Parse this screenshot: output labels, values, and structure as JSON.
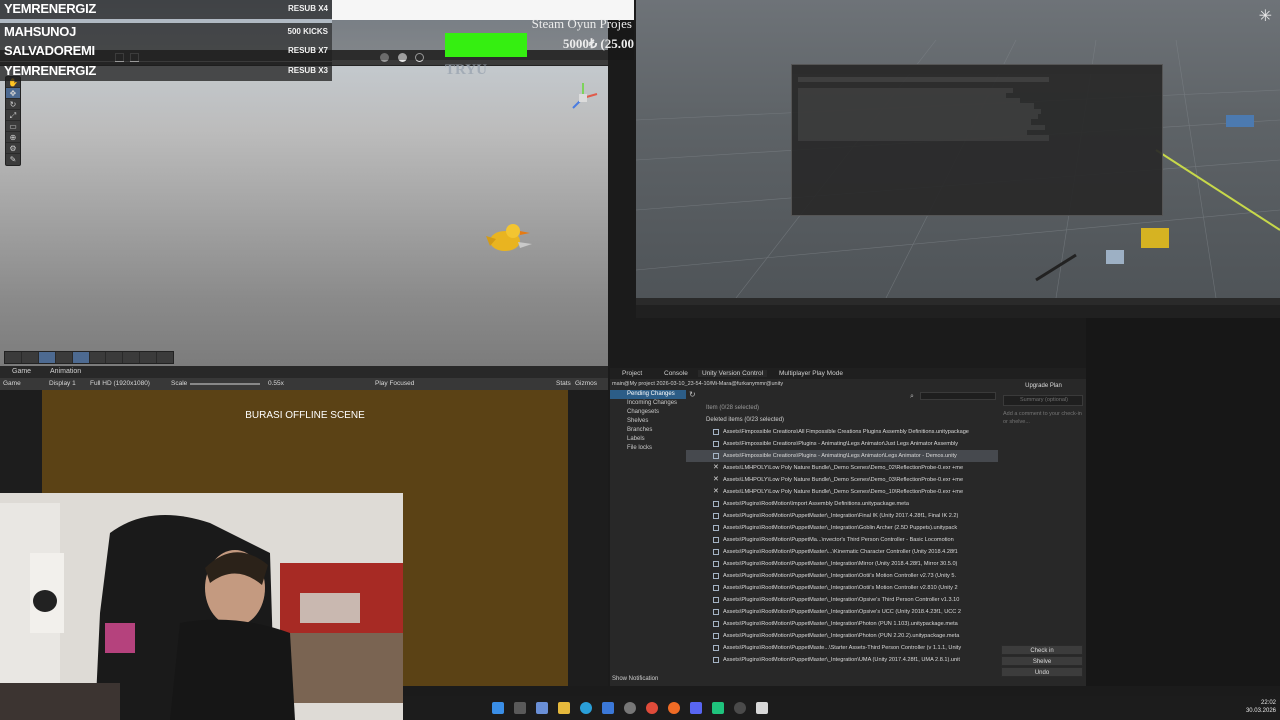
{
  "stream_overlay": {
    "rows": [
      {
        "name": "YEMRENERGIZ",
        "tag": "RESUB X4"
      },
      {
        "name": "MAHSUNOJ",
        "tag": "500 KICKS"
      },
      {
        "name": "SALVADOREMI",
        "tag": "RESUB X7"
      },
      {
        "name": "YEMRENERGIZ",
        "tag": "RESUB X3"
      }
    ],
    "goal_title": "Steam Oyun Projes",
    "goal_amount": "5000₺ (25.00",
    "goal_progress": 0.27,
    "scene_watermark": "TRYU"
  },
  "game_view": {
    "tabs": [
      "Game",
      "Animation"
    ],
    "toolbar": {
      "mode": "Game",
      "display": "Display 1",
      "resolution": "Full HD (1920x1080)",
      "scale_label": "Scale",
      "scale_value": "0.55x",
      "play_mode": "Play Focused",
      "stats": "Stats",
      "gizmos": "Gizmos"
    },
    "scene_text": "BURASI OFFLINE SCENE"
  },
  "version_control": {
    "tabs": [
      "Project",
      "Console",
      "Unity Version Control",
      "Multiplayer Play Mode"
    ],
    "path": "main@My project 2026-03-10_23-54-10/Mi-Mara@furkanymmr@unity",
    "nav": [
      "Pending Changes",
      "Incoming Changes",
      "Changesets",
      "Shelves",
      "Branches",
      "Labels",
      "File locks"
    ],
    "list_header": "Item  (0/28 selected)",
    "group": "Deleted items  (0/23 selected)",
    "rows": [
      "Assets\\Fimpossible Creations\\All Fimpossible Creations Plugins Assembly Definitions.unitypackage",
      "Assets\\Fimpossible Creations\\Plugins - Animating\\Legs Animator\\Just Legs Animator Assembly",
      "Assets\\Fimpossible Creations\\Plugins - Animating\\Legs Animator\\Legs Animator - Demos.unity",
      "Assets\\LMHPOLY\\Low Poly Nature Bundle\\_Demo Scenes\\Demo_02\\ReflectionProbe-0.exr +me",
      "Assets\\LMHPOLY\\Low Poly Nature Bundle\\_Demo Scenes\\Demo_03\\ReflectionProbe-0.exr +me",
      "Assets\\LMHPOLY\\Low Poly Nature Bundle\\_Demo Scenes\\Demo_10\\ReflectionProbe-0.exr +me",
      "Assets\\Plugins\\RootMotion\\Import Assembly Definitions.unitypackage.meta",
      "Assets\\Plugins\\RootMotion\\PuppetMaster\\_Integration\\Final IK (Unity 2017.4.28f1, Final IK 2.2)",
      "Assets\\Plugins\\RootMotion\\PuppetMaster\\_Integration\\Goblin Archer (2.5D Puppets).unitypack",
      "Assets\\Plugins\\RootMotion\\PuppetMa...\\nvector's Third Person Controller - Basic Locomotion",
      "Assets\\Plugins\\RootMotion\\PuppetMaster\\...\\Kinematic Character Controller (Unity 2018.4.28f1",
      "Assets\\Plugins\\RootMotion\\PuppetMaster\\_Integration\\Mirror (Unity 2018.4.28f1, Mirror 30.5.0)",
      "Assets\\Plugins\\RootMotion\\PuppetMaster\\_Integration\\Ootii's Motion Controller v2.73 (Unity 5.",
      "Assets\\Plugins\\RootMotion\\PuppetMaster\\_Integration\\Ootii's Motion Controller v2.810 (Unity 2",
      "Assets\\Plugins\\RootMotion\\PuppetMaster\\_Integration\\Opsive's Third Person Controller v1.3.10",
      "Assets\\Plugins\\RootMotion\\PuppetMaster\\_Integration\\Opsive's UCC (Unity 2018.4.23f1, UCC 2",
      "Assets\\Plugins\\RootMotion\\PuppetMaster\\_Integration\\Photon (PUN 1.103).unitypackage.meta",
      "Assets\\Plugins\\RootMotion\\PuppetMaster\\_Integration\\Photon (PUN 2.20.2).unitypackage.meta",
      "Assets\\Plugins\\RootMotion\\PuppetMaste...\\Starter Assets-Third Person Controller (v 1.1.1, Unity",
      "Assets\\Plugins\\RootMotion\\PuppetMaster\\_Integration\\UMA (Unity 2017.4.28f1, UMA 2.8.1).unit"
    ],
    "upgrade_plan": "Upgrade Plan",
    "summary_placeholder": "Summary (optional)",
    "comment_placeholder": "Add a comment to your check-in or shelve...",
    "buttons": [
      "Check in",
      "Shelve",
      "Undo"
    ],
    "show_notification": "Show Notification"
  },
  "taskbar": {
    "time": "22:02",
    "date": "30.03.2026"
  },
  "icons": {
    "search": "search-icon",
    "refresh": "refresh-icon",
    "windows": "windows-start-icon"
  }
}
